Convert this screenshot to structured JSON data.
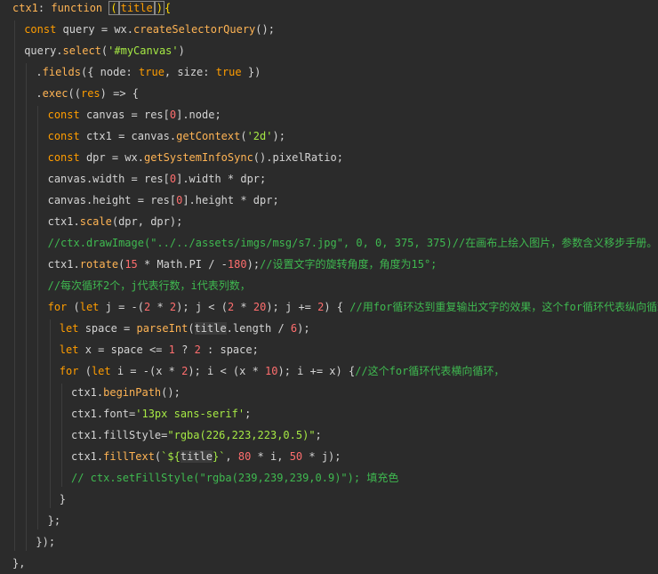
{
  "colors": {
    "background": "#2b2b2b",
    "text": "#d4d4d4",
    "keyword": "#ff9d00",
    "function": "#ffb454",
    "string": "#a5e844",
    "number": "#ff6e6e",
    "comment": "#3fb950",
    "punct": "#ffd700",
    "property": "#ffb454"
  },
  "lines": [
    {
      "indent": 0,
      "segments": [
        {
          "t": "ctx1",
          "c": "#ffb454"
        },
        {
          "t": ": ",
          "c": "#d4d4d4"
        },
        {
          "t": "function",
          "c": "#ffb454"
        },
        {
          "t": " ",
          "c": "#d4d4d4"
        },
        {
          "t": "(",
          "c": "#ffd700",
          "box": true
        },
        {
          "t": "title",
          "c": "#ff9d00",
          "box": true
        },
        {
          "t": ")",
          "c": "#ffd700",
          "box": true
        },
        {
          "t": "{",
          "c": "#ffd700"
        }
      ]
    },
    {
      "indent": 1,
      "segments": [
        {
          "t": "const",
          "c": "#ff9d00"
        },
        {
          "t": " query = wx.",
          "c": "#d4d4d4"
        },
        {
          "t": "createSelectorQuery",
          "c": "#ffb454"
        },
        {
          "t": "();",
          "c": "#d4d4d4"
        }
      ]
    },
    {
      "indent": 1,
      "segments": [
        {
          "t": "query.",
          "c": "#d4d4d4"
        },
        {
          "t": "select",
          "c": "#ffb454"
        },
        {
          "t": "(",
          "c": "#d4d4d4"
        },
        {
          "t": "'#myCanvas'",
          "c": "#a5e844"
        },
        {
          "t": ")",
          "c": "#d4d4d4"
        }
      ]
    },
    {
      "indent": 2,
      "segments": [
        {
          "t": ".",
          "c": "#d4d4d4"
        },
        {
          "t": "fields",
          "c": "#ffb454"
        },
        {
          "t": "({ node: ",
          "c": "#d4d4d4"
        },
        {
          "t": "true",
          "c": "#ff9d00"
        },
        {
          "t": ", size: ",
          "c": "#d4d4d4"
        },
        {
          "t": "true",
          "c": "#ff9d00"
        },
        {
          "t": " })",
          "c": "#d4d4d4"
        }
      ]
    },
    {
      "indent": 2,
      "segments": [
        {
          "t": ".",
          "c": "#d4d4d4"
        },
        {
          "t": "exec",
          "c": "#ffb454"
        },
        {
          "t": "((",
          "c": "#d4d4d4"
        },
        {
          "t": "res",
          "c": "#ff9d00"
        },
        {
          "t": ") => {",
          "c": "#d4d4d4"
        }
      ]
    },
    {
      "indent": 3,
      "segments": [
        {
          "t": "const",
          "c": "#ff9d00"
        },
        {
          "t": " canvas = res[",
          "c": "#d4d4d4"
        },
        {
          "t": "0",
          "c": "#ff6e6e"
        },
        {
          "t": "].node;",
          "c": "#d4d4d4"
        }
      ]
    },
    {
      "indent": 3,
      "segments": [
        {
          "t": "const",
          "c": "#ff9d00"
        },
        {
          "t": " ctx1 = canvas.",
          "c": "#d4d4d4"
        },
        {
          "t": "getContext",
          "c": "#ffb454"
        },
        {
          "t": "(",
          "c": "#d4d4d4"
        },
        {
          "t": "'2d'",
          "c": "#a5e844"
        },
        {
          "t": ");",
          "c": "#d4d4d4"
        }
      ]
    },
    {
      "indent": 3,
      "segments": [
        {
          "t": "const",
          "c": "#ff9d00"
        },
        {
          "t": " dpr = wx.",
          "c": "#d4d4d4"
        },
        {
          "t": "getSystemInfoSync",
          "c": "#ffb454"
        },
        {
          "t": "().pixelRatio;",
          "c": "#d4d4d4"
        }
      ]
    },
    {
      "indent": 3,
      "segments": [
        {
          "t": "canvas.width = res[",
          "c": "#d4d4d4"
        },
        {
          "t": "0",
          "c": "#ff6e6e"
        },
        {
          "t": "].width * dpr;",
          "c": "#d4d4d4"
        }
      ]
    },
    {
      "indent": 3,
      "segments": [
        {
          "t": "canvas.height = res[",
          "c": "#d4d4d4"
        },
        {
          "t": "0",
          "c": "#ff6e6e"
        },
        {
          "t": "].height * dpr;",
          "c": "#d4d4d4"
        }
      ]
    },
    {
      "indent": 3,
      "segments": [
        {
          "t": "ctx1.",
          "c": "#d4d4d4"
        },
        {
          "t": "scale",
          "c": "#ffb454"
        },
        {
          "t": "(dpr, dpr);",
          "c": "#d4d4d4"
        }
      ]
    },
    {
      "indent": 3,
      "segments": [
        {
          "t": "//ctx.drawImage(\"../../assets/imgs/msg/s7.jpg\", 0, 0, 375, 375)//在画布上绘入图片，参数含义移步手册。",
          "c": "#3fb950"
        }
      ]
    },
    {
      "indent": 3,
      "segments": [
        {
          "t": "ctx1.",
          "c": "#d4d4d4"
        },
        {
          "t": "rotate",
          "c": "#ffb454"
        },
        {
          "t": "(",
          "c": "#d4d4d4"
        },
        {
          "t": "15",
          "c": "#ff6e6e"
        },
        {
          "t": " * Math.PI / -",
          "c": "#d4d4d4"
        },
        {
          "t": "180",
          "c": "#ff6e6e"
        },
        {
          "t": ");",
          "c": "#d4d4d4"
        },
        {
          "t": "//设置文字的旋转角度，角度为15°;",
          "c": "#3fb950"
        }
      ]
    },
    {
      "indent": 3,
      "segments": [
        {
          "t": "//每次循环2个，j代表行数，i代表列数，",
          "c": "#3fb950"
        }
      ]
    },
    {
      "indent": 3,
      "segments": [
        {
          "t": "for",
          "c": "#ff9d00"
        },
        {
          "t": " (",
          "c": "#d4d4d4"
        },
        {
          "t": "let",
          "c": "#ff9d00"
        },
        {
          "t": " j = -(",
          "c": "#d4d4d4"
        },
        {
          "t": "2",
          "c": "#ff6e6e"
        },
        {
          "t": " * ",
          "c": "#d4d4d4"
        },
        {
          "t": "2",
          "c": "#ff6e6e"
        },
        {
          "t": "); j < (",
          "c": "#d4d4d4"
        },
        {
          "t": "2",
          "c": "#ff6e6e"
        },
        {
          "t": " * ",
          "c": "#d4d4d4"
        },
        {
          "t": "20",
          "c": "#ff6e6e"
        },
        {
          "t": "); j += ",
          "c": "#d4d4d4"
        },
        {
          "t": "2",
          "c": "#ff6e6e"
        },
        {
          "t": ") { ",
          "c": "#d4d4d4"
        },
        {
          "t": "//用for循环达到重复输出文字的效果，这个for循环代表纵向循环",
          "c": "#3fb950"
        }
      ]
    },
    {
      "indent": 4,
      "segments": [
        {
          "t": "let",
          "c": "#ff9d00"
        },
        {
          "t": " space = ",
          "c": "#d4d4d4"
        },
        {
          "t": "parseInt",
          "c": "#ffb454"
        },
        {
          "t": "(",
          "c": "#d4d4d4"
        },
        {
          "t": "title",
          "c": "#d4d4d4",
          "hl": true
        },
        {
          "t": ".length / ",
          "c": "#d4d4d4"
        },
        {
          "t": "6",
          "c": "#ff6e6e"
        },
        {
          "t": ");",
          "c": "#d4d4d4"
        }
      ]
    },
    {
      "indent": 4,
      "segments": [
        {
          "t": "let",
          "c": "#ff9d00"
        },
        {
          "t": " x = space <= ",
          "c": "#d4d4d4"
        },
        {
          "t": "1",
          "c": "#ff6e6e"
        },
        {
          "t": " ? ",
          "c": "#d4d4d4"
        },
        {
          "t": "2",
          "c": "#ff6e6e"
        },
        {
          "t": " : space;",
          "c": "#d4d4d4"
        }
      ]
    },
    {
      "indent": 4,
      "segments": [
        {
          "t": "for",
          "c": "#ff9d00"
        },
        {
          "t": " (",
          "c": "#d4d4d4"
        },
        {
          "t": "let",
          "c": "#ff9d00"
        },
        {
          "t": " i = -(x * ",
          "c": "#d4d4d4"
        },
        {
          "t": "2",
          "c": "#ff6e6e"
        },
        {
          "t": "); i < (x * ",
          "c": "#d4d4d4"
        },
        {
          "t": "10",
          "c": "#ff6e6e"
        },
        {
          "t": "); i += x) {",
          "c": "#d4d4d4"
        },
        {
          "t": "//这个for循环代表横向循环，",
          "c": "#3fb950"
        }
      ]
    },
    {
      "indent": 5,
      "segments": [
        {
          "t": "ctx1.",
          "c": "#d4d4d4"
        },
        {
          "t": "beginPath",
          "c": "#ffb454"
        },
        {
          "t": "();",
          "c": "#d4d4d4"
        }
      ]
    },
    {
      "indent": 5,
      "segments": [
        {
          "t": "ctx1.font=",
          "c": "#d4d4d4"
        },
        {
          "t": "'13px sans-serif'",
          "c": "#a5e844"
        },
        {
          "t": ";",
          "c": "#d4d4d4"
        }
      ]
    },
    {
      "indent": 5,
      "segments": [
        {
          "t": "ctx1.fillStyle=",
          "c": "#d4d4d4"
        },
        {
          "t": "\"rgba(226,223,223,0.5)\"",
          "c": "#a5e844"
        },
        {
          "t": ";",
          "c": "#d4d4d4"
        }
      ]
    },
    {
      "indent": 5,
      "segments": [
        {
          "t": "ctx1.",
          "c": "#d4d4d4"
        },
        {
          "t": "fillText",
          "c": "#ffb454"
        },
        {
          "t": "(",
          "c": "#d4d4d4"
        },
        {
          "t": "`${",
          "c": "#a5e844"
        },
        {
          "t": "title",
          "c": "#d4d4d4",
          "hl": true
        },
        {
          "t": "}`",
          "c": "#a5e844"
        },
        {
          "t": ", ",
          "c": "#d4d4d4"
        },
        {
          "t": "80",
          "c": "#ff6e6e"
        },
        {
          "t": " * i, ",
          "c": "#d4d4d4"
        },
        {
          "t": "50",
          "c": "#ff6e6e"
        },
        {
          "t": " * j);",
          "c": "#d4d4d4"
        }
      ]
    },
    {
      "indent": 5,
      "segments": [
        {
          "t": "// ctx.setFillStyle(\"rgba(239,239,239,0.9)\"); 填充色",
          "c": "#3fb950"
        }
      ]
    },
    {
      "indent": 4,
      "segments": [
        {
          "t": "}",
          "c": "#d4d4d4"
        }
      ]
    },
    {
      "indent": 3,
      "segments": [
        {
          "t": "};",
          "c": "#d4d4d4"
        }
      ]
    },
    {
      "indent": 2,
      "segments": [
        {
          "t": "});",
          "c": "#d4d4d4"
        }
      ]
    },
    {
      "indent": 0,
      "segments": [
        {
          "t": "},",
          "c": "#d4d4d4"
        }
      ]
    }
  ]
}
